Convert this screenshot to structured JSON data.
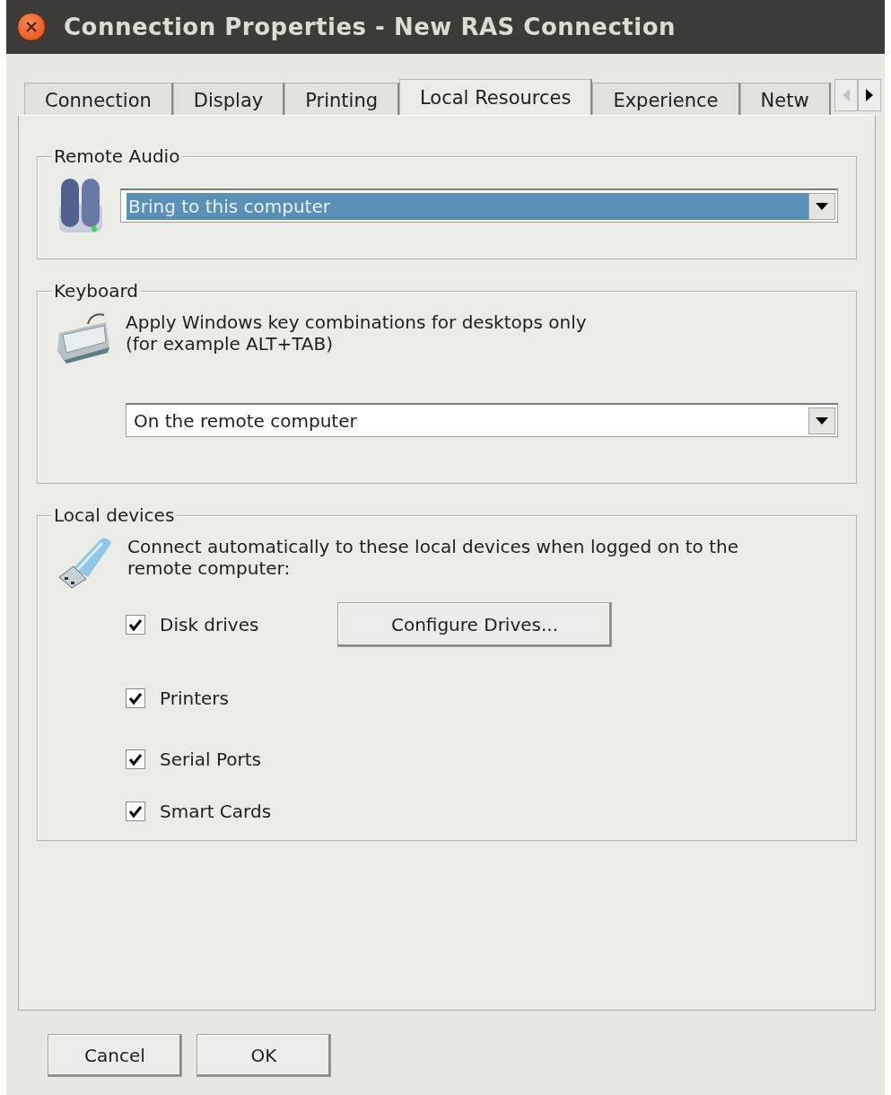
{
  "window": {
    "title": "Connection Properties - New RAS Connection"
  },
  "tabs": [
    {
      "label": "Connection",
      "selected": false
    },
    {
      "label": "Display",
      "selected": false
    },
    {
      "label": "Printing",
      "selected": false
    },
    {
      "label": "Local Resources",
      "selected": true
    },
    {
      "label": "Experience",
      "selected": false
    },
    {
      "label": "Netw",
      "selected": false
    }
  ],
  "remote_audio": {
    "legend": "Remote Audio",
    "dropdown": {
      "value": "Bring to this computer",
      "highlighted": true
    }
  },
  "keyboard": {
    "legend": "Keyboard",
    "description": "Apply Windows key combinations for desktops only\n(for example ALT+TAB)",
    "dropdown": {
      "value": "On the remote computer",
      "highlighted": false
    }
  },
  "local_devices": {
    "legend": "Local devices",
    "description": "Connect automatically to these local devices when logged on to the\nremote computer:",
    "configure_button": {
      "label": "Configure Drives..."
    },
    "devices": [
      {
        "label": "Disk drives",
        "checked": true
      },
      {
        "label": "Printers",
        "checked": true
      },
      {
        "label": "Serial Ports",
        "checked": true
      },
      {
        "label": "Smart Cards",
        "checked": true
      }
    ]
  },
  "buttons": [
    {
      "label": "Cancel"
    },
    {
      "label": "OK"
    }
  ]
}
